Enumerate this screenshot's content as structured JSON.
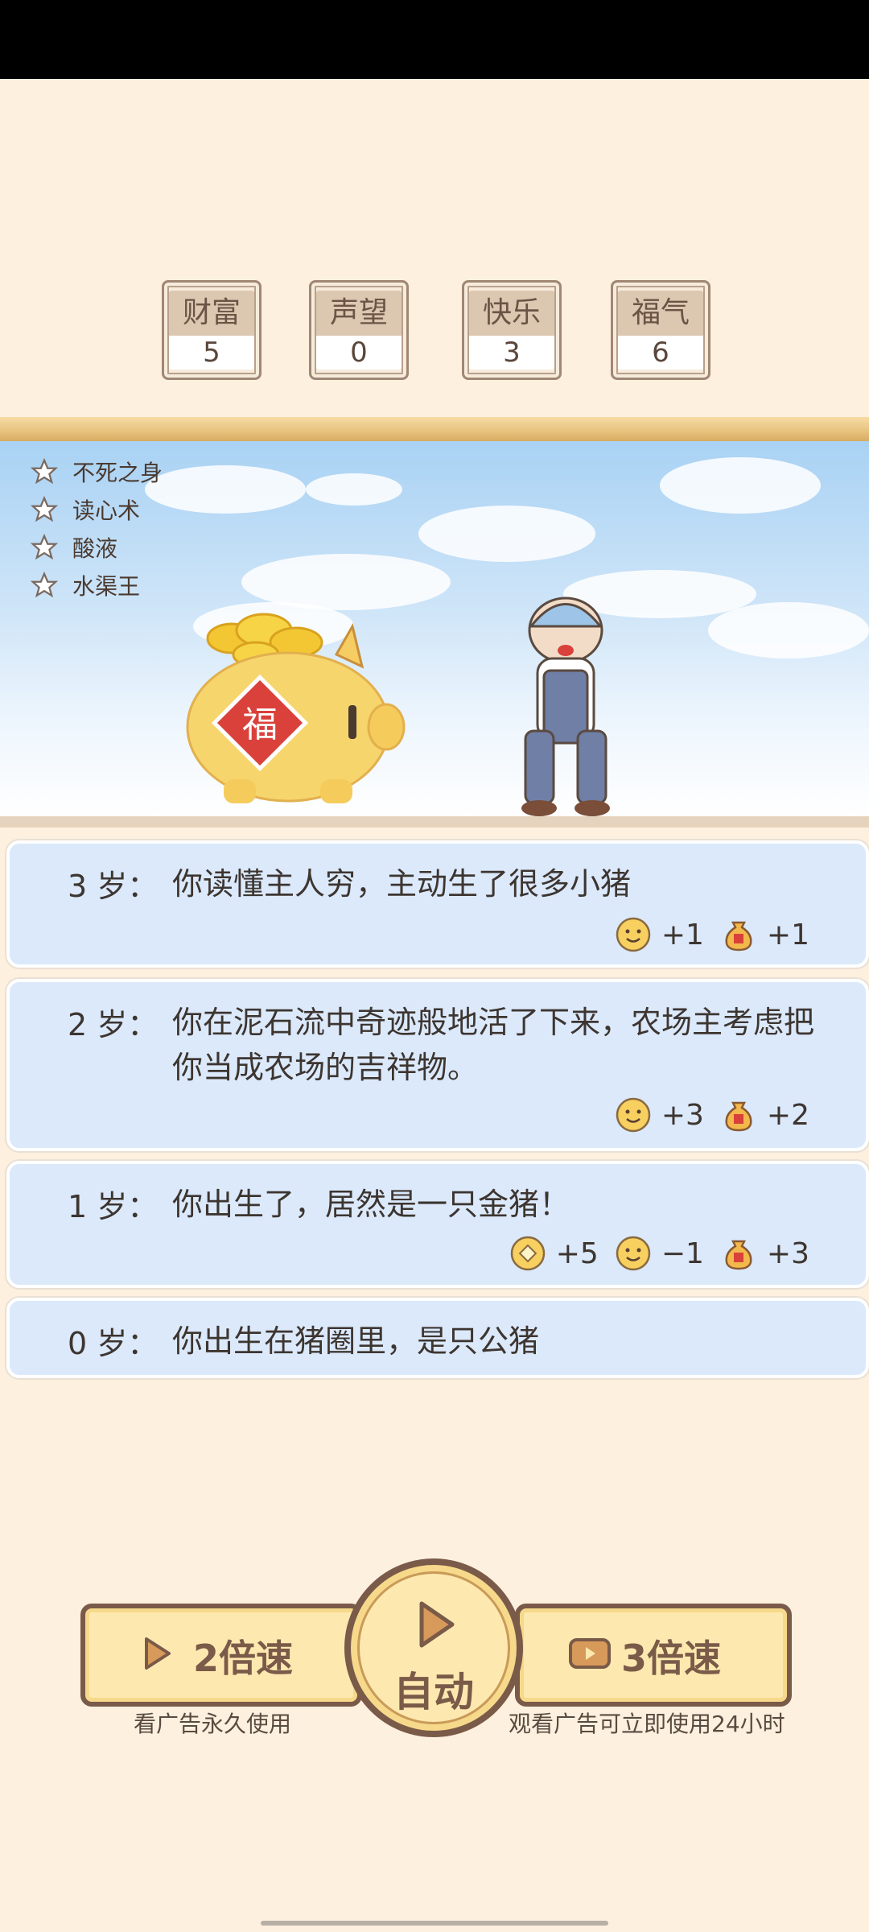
{
  "stats": [
    {
      "label": "财富",
      "value": "5"
    },
    {
      "label": "声望",
      "value": "0"
    },
    {
      "label": "快乐",
      "value": "3"
    },
    {
      "label": "福气",
      "value": "6"
    }
  ],
  "talents": [
    "不死之身",
    "读心术",
    "酸液",
    "水渠王"
  ],
  "log": [
    {
      "age": "3 岁：",
      "text": "你读懂主人穷，主动生了很多小猪",
      "effects": [
        {
          "icon": "smile-icon",
          "value": "+1"
        },
        {
          "icon": "lucky-bag-icon",
          "value": "+1"
        }
      ]
    },
    {
      "age": "2 岁：",
      "text": "你在泥石流中奇迹般地活了下来，农场主考虑把你当成农场的吉祥物。",
      "effects": [
        {
          "icon": "smile-icon",
          "value": "+3"
        },
        {
          "icon": "lucky-bag-icon",
          "value": "+2"
        }
      ]
    },
    {
      "age": "1 岁：",
      "text": "你出生了，居然是一只金猪！",
      "effects": [
        {
          "icon": "coin-icon",
          "value": "+5"
        },
        {
          "icon": "smile-icon",
          "value": "−1"
        },
        {
          "icon": "lucky-bag-icon",
          "value": "+3"
        }
      ]
    },
    {
      "age": "0 岁：",
      "text": "你出生在猪圈里，是只公猪",
      "effects": []
    }
  ],
  "controls": {
    "speed2_label": "2倍速",
    "speed2_caption": "看广告永久使用",
    "auto_label": "自动",
    "speed3_label": "3倍速",
    "speed3_caption": "观看广告可立即使用24小时"
  },
  "colors": {
    "background": "#fdf0df",
    "card": "#dbe9fb",
    "button": "#fde9b0",
    "button_border": "#7a5a48"
  },
  "pig_badge_text": "福"
}
